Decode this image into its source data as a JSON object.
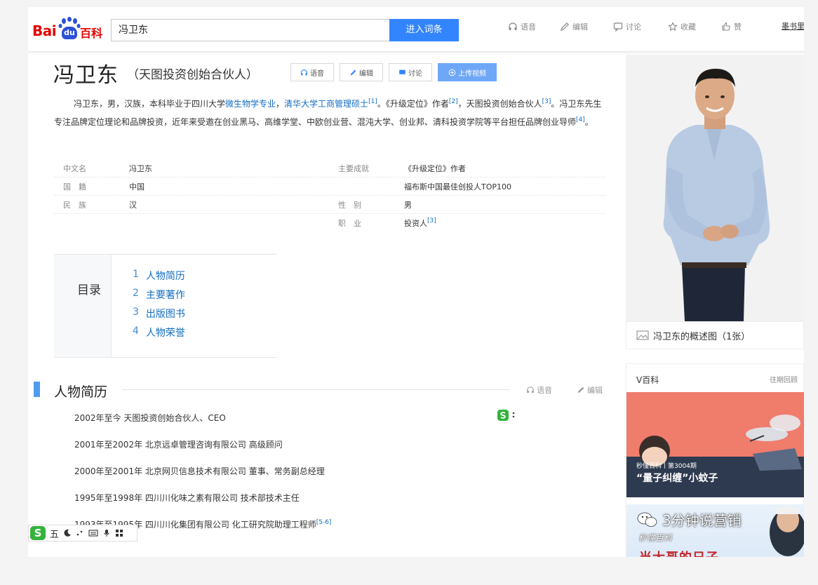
{
  "header": {
    "logo": {
      "left": "Bai",
      "mid": "du",
      "right": "百科"
    },
    "search_value": "冯卫东",
    "search_button": "进入词条",
    "tools": [
      {
        "icon": "headphones-icon",
        "label": "语音"
      },
      {
        "icon": "pencil-icon",
        "label": "编辑"
      },
      {
        "icon": "chat-icon",
        "label": "讨论"
      },
      {
        "icon": "star-icon",
        "label": "收藏"
      },
      {
        "icon": "thumbs-up-icon",
        "label": "赞"
      }
    ],
    "user_link": "墨书里"
  },
  "entry": {
    "title": "冯卫东",
    "subtitle": "（天图投资创始合伙人）",
    "buttons": {
      "voice": "语音",
      "edit": "编辑",
      "discuss": "讨论",
      "upload_video": "上传视频"
    },
    "summary": {
      "p1": "冯卫东，男，汉族，本科毕业于四川大学",
      "link1": "微生物学专业",
      "sep1": "，",
      "link2": "清华大学工商管理硕士",
      "ref1": "[1]",
      "p2": "。《升级定位》作者",
      "ref2": "[2]",
      "p3": "，天图投资创始合伙人",
      "ref3": "[3]",
      "p4": "。冯卫东先生专注品牌定位理论和品牌投资，近年来受邀在创业黑马、高维学堂、中欧创业营、混沌大学、创业邦、清科投资学院等平台担任品牌创业导师",
      "ref4": "[4]",
      "p5": "。"
    },
    "basic_info": {
      "chinese_name_label": "中文名",
      "chinese_name": "冯卫东",
      "nationality_label": "国　籍",
      "nationality": "中国",
      "ethnicity_label": "民　族",
      "ethnicity": "汉",
      "works_label": "主要成就",
      "works": "《升级定位》作者",
      "honor": "福布斯中国最佳创投人TOP100",
      "gender_label": "性　别",
      "gender": "男",
      "occupation_label": "职　业",
      "occupation": "投资人",
      "occupation_ref": "[3]"
    }
  },
  "catalog": {
    "title": "目录",
    "items": [
      {
        "num": "1",
        "label": "人物简历"
      },
      {
        "num": "2",
        "label": "主要著作"
      },
      {
        "num": "3",
        "label": "出版图书"
      },
      {
        "num": "4",
        "label": "人物荣誉"
      }
    ]
  },
  "section": {
    "title": "人物简历",
    "voice": "语音",
    "edit": "编辑",
    "career": [
      "2002年至今 天图投资创始合伙人、CEO",
      "2001年至2002年 北京远卓管理咨询有限公司 高级顾问",
      "2000年至2001年 北京网贝信息技术有限公司 董事、常务副总经理",
      "1995年至1998年 四川川化味之素有限公司 技术部技术主任",
      "1993年至1995年 四川川化集团有限公司 化工研究院助理工程师"
    ],
    "career_last_ref": "[5-6]"
  },
  "sidebar": {
    "photo_caption": "冯卫东的概述图（1张）",
    "vbaike": {
      "title": "V百科",
      "more": "往期回顾",
      "episode": "秒懂百科丨第3004期",
      "video_title": "“量子纠缠”小蚊子",
      "promo_text": "当大哥的日子"
    }
  },
  "watermark": {
    "text": "3分钟说营销",
    "sub": "秒懂百科"
  },
  "ime": {
    "logo": "S",
    "mode": "五"
  },
  "colors": {
    "accent": "#3385ff",
    "link": "#136ec2",
    "brand_red": "#e10602",
    "section_marker": "#4f9cee"
  }
}
